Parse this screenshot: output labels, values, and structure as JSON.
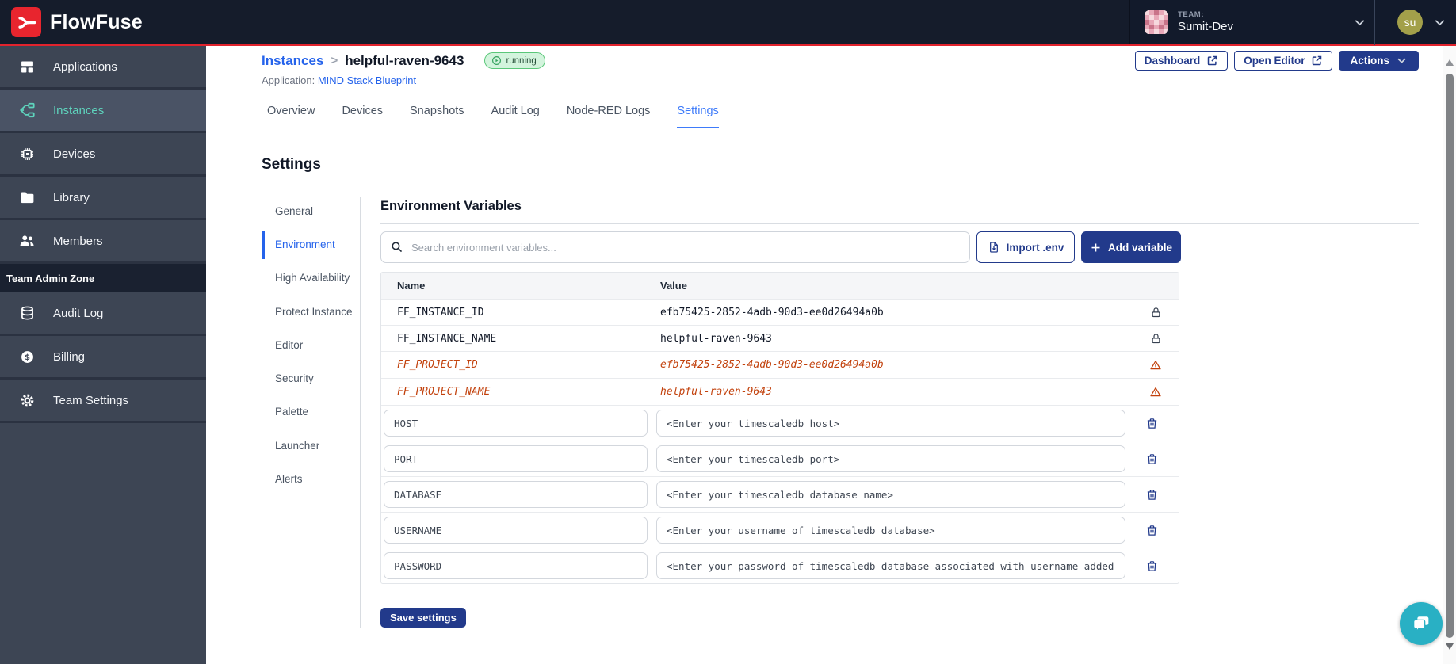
{
  "topbar": {
    "brand": "FlowFuse",
    "team": {
      "label": "TEAM:",
      "name": "Sumit-Dev"
    },
    "user_initials": "su"
  },
  "sidebar": {
    "items": [
      "Applications",
      "Instances",
      "Devices",
      "Library",
      "Members"
    ],
    "active_item": "Instances",
    "admin_zone_label": "Team Admin Zone",
    "admin_items": [
      "Audit Log",
      "Billing",
      "Team Settings"
    ]
  },
  "header": {
    "breadcrumb": {
      "parent": "Instances",
      "separator": ">",
      "current": "helpful-raven-9643"
    },
    "status_badge": "running",
    "application": {
      "label": "Application:",
      "name": "MIND Stack Blueprint"
    },
    "actions": {
      "dashboard": "Dashboard",
      "open_editor": "Open Editor",
      "actions": "Actions"
    }
  },
  "tabs": {
    "items": [
      "Overview",
      "Devices",
      "Snapshots",
      "Audit Log",
      "Node-RED Logs",
      "Settings"
    ],
    "active": "Settings"
  },
  "settings": {
    "title": "Settings",
    "nav": [
      "General",
      "Environment",
      "High Availability",
      "Protect Instance",
      "Editor",
      "Security",
      "Palette",
      "Launcher",
      "Alerts"
    ],
    "active_nav": "Environment",
    "environment": {
      "title": "Environment Variables",
      "search_placeholder": "Search environment variables...",
      "import_button": "Import .env",
      "add_button": "Add variable",
      "columns": {
        "name": "Name",
        "value": "Value"
      },
      "locked_rows": [
        {
          "name": "FF_INSTANCE_ID",
          "value": "efb75425-2852-4adb-90d3-ee0d26494a0b",
          "state": "locked"
        },
        {
          "name": "FF_INSTANCE_NAME",
          "value": "helpful-raven-9643",
          "state": "locked"
        },
        {
          "name": "FF_PROJECT_ID",
          "value": "efb75425-2852-4adb-90d3-ee0d26494a0b",
          "state": "deprecated"
        },
        {
          "name": "FF_PROJECT_NAME",
          "value": "helpful-raven-9643",
          "state": "deprecated"
        }
      ],
      "editable_rows": [
        {
          "name": "HOST",
          "value": "<Enter your timescaledb host>"
        },
        {
          "name": "PORT",
          "value": "<Enter your timescaledb port>"
        },
        {
          "name": "DATABASE",
          "value": "<Enter your timescaledb database name>"
        },
        {
          "name": "USERNAME",
          "value": "<Enter your username of timescaledb database>"
        },
        {
          "name": "PASSWORD",
          "value": "<Enter your password of timescaledb database associated with username added"
        }
      ],
      "save_button": "Save settings"
    }
  },
  "colors": {
    "brand_red": "#e2232d",
    "primary_navy": "#223a8b",
    "link_blue": "#2563eb",
    "active_tab_blue": "#3e7bfa",
    "sidebar_teal": "#5ed4bd",
    "warning_orange": "#c2410c",
    "running_badge_bg": "#d3f4dd",
    "running_badge_border": "#5bc779",
    "chat_teal": "#29b0c4"
  }
}
